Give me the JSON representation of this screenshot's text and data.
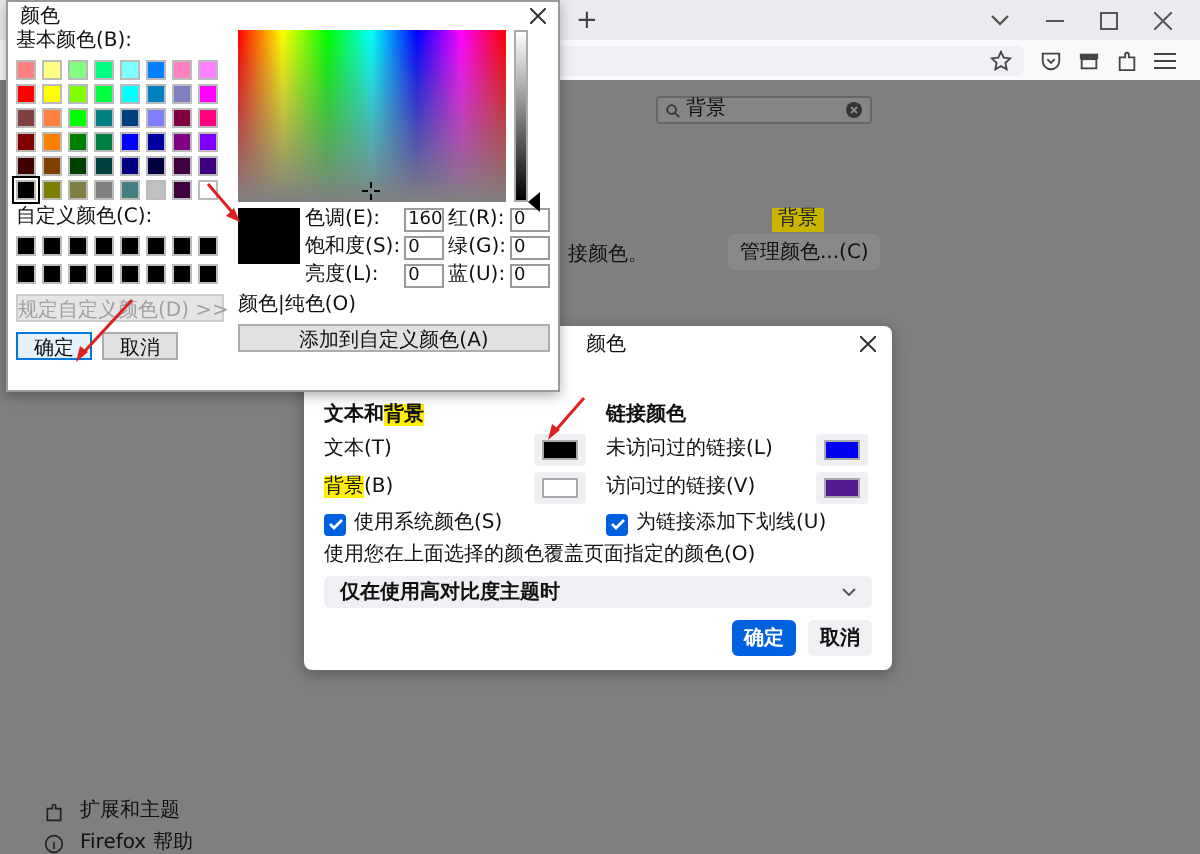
{
  "browser": {
    "new_tab": "+",
    "search": {
      "value": "背景"
    },
    "partial_text": "接颜色。",
    "highlight_badge": "背景",
    "manage_colors_button": "管理颜色...(C)",
    "sidebar_items": [
      {
        "label": "扩展和主题",
        "kind": "addons"
      },
      {
        "label": "Firefox 帮助",
        "kind": "help"
      }
    ]
  },
  "color_picker": {
    "title": "颜色",
    "basic_label": "基本颜色(B):",
    "basic_colors": [
      {
        "color": "#ff8080",
        "selected": false
      },
      {
        "color": "#ffff80",
        "selected": false
      },
      {
        "color": "#80ff80",
        "selected": false
      },
      {
        "color": "#00ff80",
        "selected": false
      },
      {
        "color": "#80ffff",
        "selected": false
      },
      {
        "color": "#0080ff",
        "selected": false
      },
      {
        "color": "#ff80c0",
        "selected": false
      },
      {
        "color": "#ff80ff",
        "selected": false
      },
      {
        "color": "#ff0000",
        "selected": false
      },
      {
        "color": "#ffff00",
        "selected": false
      },
      {
        "color": "#80ff00",
        "selected": false
      },
      {
        "color": "#00ff40",
        "selected": false
      },
      {
        "color": "#00ffff",
        "selected": false
      },
      {
        "color": "#0080c0",
        "selected": false
      },
      {
        "color": "#8080c0",
        "selected": false
      },
      {
        "color": "#ff00ff",
        "selected": false
      },
      {
        "color": "#804040",
        "selected": false
      },
      {
        "color": "#ff8040",
        "selected": false
      },
      {
        "color": "#00ff00",
        "selected": false
      },
      {
        "color": "#008080",
        "selected": false
      },
      {
        "color": "#004080",
        "selected": false
      },
      {
        "color": "#8080ff",
        "selected": false
      },
      {
        "color": "#800040",
        "selected": false
      },
      {
        "color": "#ff0080",
        "selected": false
      },
      {
        "color": "#800000",
        "selected": false
      },
      {
        "color": "#ff8000",
        "selected": false
      },
      {
        "color": "#008000",
        "selected": false
      },
      {
        "color": "#008040",
        "selected": false
      },
      {
        "color": "#0000ff",
        "selected": false
      },
      {
        "color": "#0000a0",
        "selected": false
      },
      {
        "color": "#800080",
        "selected": false
      },
      {
        "color": "#8000ff",
        "selected": false
      },
      {
        "color": "#400000",
        "selected": false
      },
      {
        "color": "#804000",
        "selected": false
      },
      {
        "color": "#004000",
        "selected": false
      },
      {
        "color": "#004040",
        "selected": false
      },
      {
        "color": "#000080",
        "selected": false
      },
      {
        "color": "#000040",
        "selected": false
      },
      {
        "color": "#400040",
        "selected": false
      },
      {
        "color": "#400080",
        "selected": false
      },
      {
        "color": "#000000",
        "selected": true
      },
      {
        "color": "#808000",
        "selected": false
      },
      {
        "color": "#808040",
        "selected": false
      },
      {
        "color": "#808080",
        "selected": false
      },
      {
        "color": "#408080",
        "selected": false
      },
      {
        "color": "#c0c0c0",
        "selected": false
      },
      {
        "color": "#400040",
        "selected": false
      },
      {
        "color": "#ffffff",
        "selected": false
      }
    ],
    "custom_label": "自定义颜色(C):",
    "custom_colors": [
      {
        "color": "#000000"
      },
      {
        "color": "#000000"
      },
      {
        "color": "#000000"
      },
      {
        "color": "#000000"
      },
      {
        "color": "#000000"
      },
      {
        "color": "#000000"
      },
      {
        "color": "#000000"
      },
      {
        "color": "#000000"
      },
      {
        "color": "#000000"
      },
      {
        "color": "#000000"
      },
      {
        "color": "#000000"
      },
      {
        "color": "#000000"
      },
      {
        "color": "#000000"
      },
      {
        "color": "#000000"
      },
      {
        "color": "#000000"
      },
      {
        "color": "#000000"
      }
    ],
    "define_button": {
      "label": "规定自定义颜色(D) >>",
      "disabled": true
    },
    "ok_button": "确定",
    "cancel_button": "取消",
    "luminance": {
      "level": 0
    },
    "preview_label": "颜色|纯色(O)",
    "fields": [
      {
        "label": "色调(E):",
        "value": "160"
      },
      {
        "label": "红(R):",
        "value": "0"
      },
      {
        "label": "饱和度(S):",
        "value": "0"
      },
      {
        "label": "绿(G):",
        "value": "0"
      },
      {
        "label": "亮度(L):",
        "value": "0"
      },
      {
        "label": "蓝(U):",
        "value": "0"
      }
    ],
    "add_button": "添加到自定义颜色(A)"
  },
  "colors_dialog": {
    "title": "颜色",
    "sections": [
      {
        "heading": [
          {
            "text": "文本和",
            "highlight": false
          },
          {
            "text": "背景",
            "highlight": true
          }
        ],
        "rows": [
          {
            "label": [
              {
                "text": "文本(T)",
                "highlight": false
              }
            ],
            "color": "#000000"
          },
          {
            "label": [
              {
                "text": "背景",
                "highlight": true
              },
              {
                "text": "(B)",
                "highlight": false
              }
            ],
            "color": "#ffffff"
          }
        ]
      },
      {
        "heading": [
          {
            "text": "链接颜色",
            "highlight": false
          }
        ],
        "rows": [
          {
            "label": [
              {
                "text": "未访问过的链接(L)",
                "highlight": false
              }
            ],
            "color": "#0000ee"
          },
          {
            "label": [
              {
                "text": "访问过的链接(V)",
                "highlight": false
              }
            ],
            "color": "#551a8b"
          }
        ]
      }
    ],
    "checkboxes": [
      {
        "label": "使用系统颜色(S)",
        "checked": true
      },
      {
        "label": "为链接添加下划线(U)",
        "checked": true
      }
    ],
    "override_label": "使用您在上面选择的颜色覆盖页面指定的颜色(O)",
    "override_select": {
      "value": "仅在使用高对比度主题时"
    },
    "ok_button": "确定",
    "cancel_button": "取消"
  }
}
